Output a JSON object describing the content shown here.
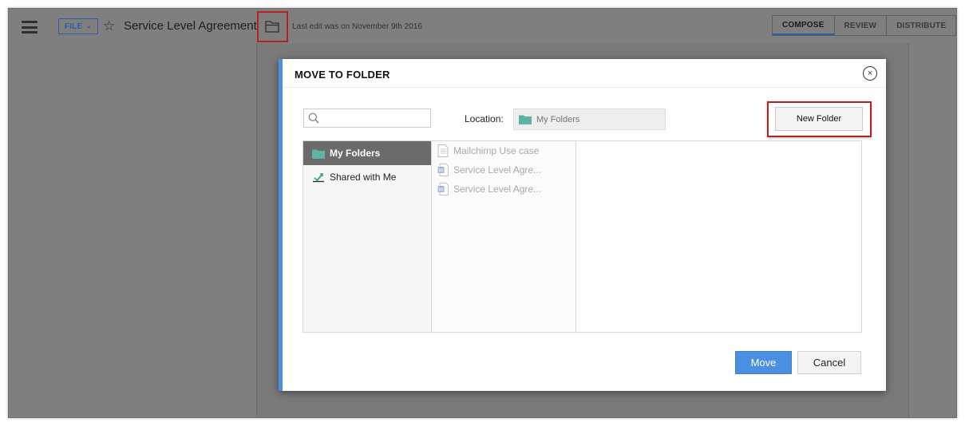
{
  "topbar": {
    "file_label": "FILE",
    "file_chevron": "⌄",
    "star_glyph": "☆",
    "document_title": "Service Level Agreement",
    "last_edit": "Last edit was on November 9th 2016",
    "mode_tabs": [
      "COMPOSE",
      "REVIEW",
      "DISTRIBUTE"
    ],
    "active_mode": "COMPOSE"
  },
  "modal": {
    "title": "MOVE TO FOLDER",
    "close_glyph": "×",
    "search": {
      "value": "",
      "placeholder": ""
    },
    "location_label": "Location:",
    "location_value": "My Folders",
    "new_folder_label": "New Folder",
    "nav": [
      {
        "label": "My Folders",
        "icon": "folder-icon",
        "selected": true
      },
      {
        "label": "Shared with Me",
        "icon": "shared-icon",
        "selected": false
      }
    ],
    "files": [
      {
        "name": "Mailchimp Use case",
        "icon": "document-icon"
      },
      {
        "name": "Service Level Agre...",
        "icon": "word-document-icon"
      },
      {
        "name": "Service Level Agre...",
        "icon": "word-document-icon"
      }
    ],
    "move_label": "Move",
    "cancel_label": "Cancel"
  },
  "colors": {
    "accent": "#4a90e2",
    "highlight_border": "#b22222",
    "folder_teal": "#5fb3a3",
    "selected_nav_bg": "#6b6b6b",
    "overlay": "#7f7f7f"
  }
}
